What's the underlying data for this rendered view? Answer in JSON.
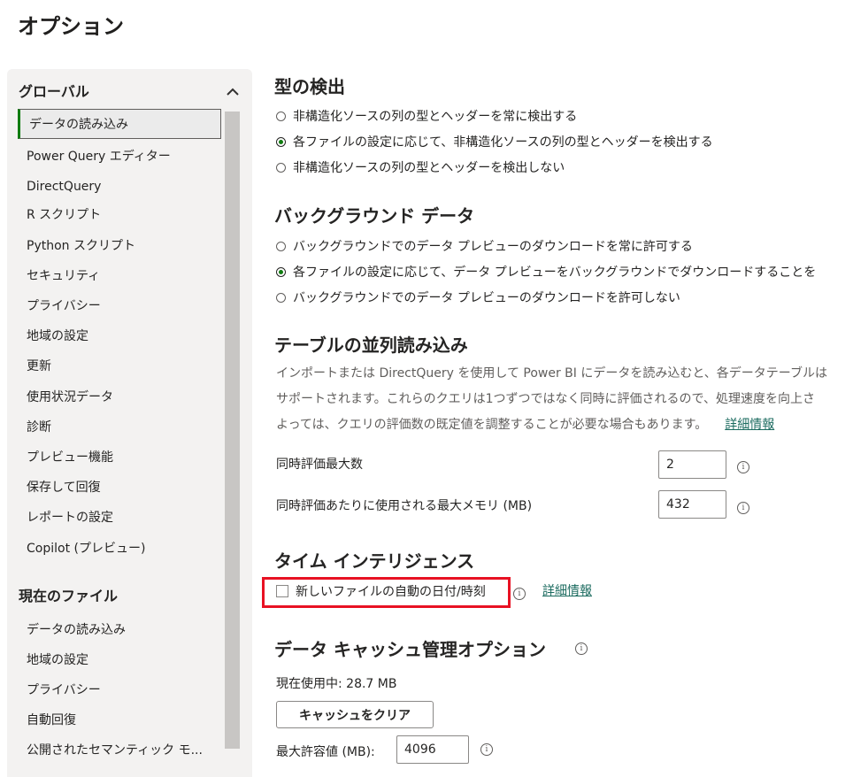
{
  "title": "オプション",
  "sidebar": {
    "global_heading": "グローバル",
    "global_items": [
      "データの読み込み",
      "Power Query エディター",
      "DirectQuery",
      "R スクリプト",
      "Python スクリプト",
      "セキュリティ",
      "プライバシー",
      "地域の設定",
      "更新",
      "使用状況データ",
      "診断",
      "プレビュー機能",
      "保存して回復",
      "レポートの設定",
      "Copilot (プレビュー)"
    ],
    "file_heading": "現在のファイル",
    "file_items": [
      "データの読み込み",
      "地域の設定",
      "プライバシー",
      "自動回復",
      "公開されたセマンティック モ..."
    ],
    "scroll_up_icon": "chevron-up-icon"
  },
  "type_detection": {
    "heading": "型の検出",
    "options": [
      "非構造化ソースの列の型とヘッダーを常に検出する",
      "各ファイルの設定に応じて、非構造化ソースの列の型とヘッダーを検出する",
      "非構造化ソースの列の型とヘッダーを検出しない"
    ],
    "selected_index": 1
  },
  "background_data": {
    "heading": "バックグラウンド データ",
    "options": [
      "バックグラウンドでのデータ プレビューのダウンロードを常に許可する",
      "各ファイルの設定に応じて、データ プレビューをバックグラウンドでダウンロードすることを",
      "バックグラウンドでのデータ プレビューのダウンロードを許可しない"
    ],
    "selected_index": 1
  },
  "parallel_loading": {
    "heading": "テーブルの並列読み込み",
    "description_lines": [
      "インポートまたは DirectQuery を使用して Power BI にデータを読み込むと、各データテーブルは",
      "サポートされます。これらのクエリは1つずつではなく同時に評価されるので、処理速度を向上さ",
      "よっては、クエリの評価数の既定値を調整することが必要な場合もあります。"
    ],
    "more_info_link": "詳細情報",
    "max_concurrent_label": "同時評価最大数",
    "max_concurrent_value": "2",
    "max_memory_label": "同時評価あたりに使用される最大メモリ (MB)",
    "max_memory_value": "432"
  },
  "time_intelligence": {
    "heading": "タイム インテリジェンス",
    "checkbox_label": "新しいファイルの自動の日付/時刻",
    "checked": false,
    "more_info_link": "詳細情報"
  },
  "cache": {
    "heading": "データ キャッシュ管理オプション",
    "current_usage": "現在使用中: 28.7 MB",
    "clear_button": "キャッシュをクリア",
    "max_label": "最大許容値 (MB):",
    "max_value": "4096"
  },
  "colors": {
    "accent": "#107c10",
    "highlight": "#e81123"
  }
}
